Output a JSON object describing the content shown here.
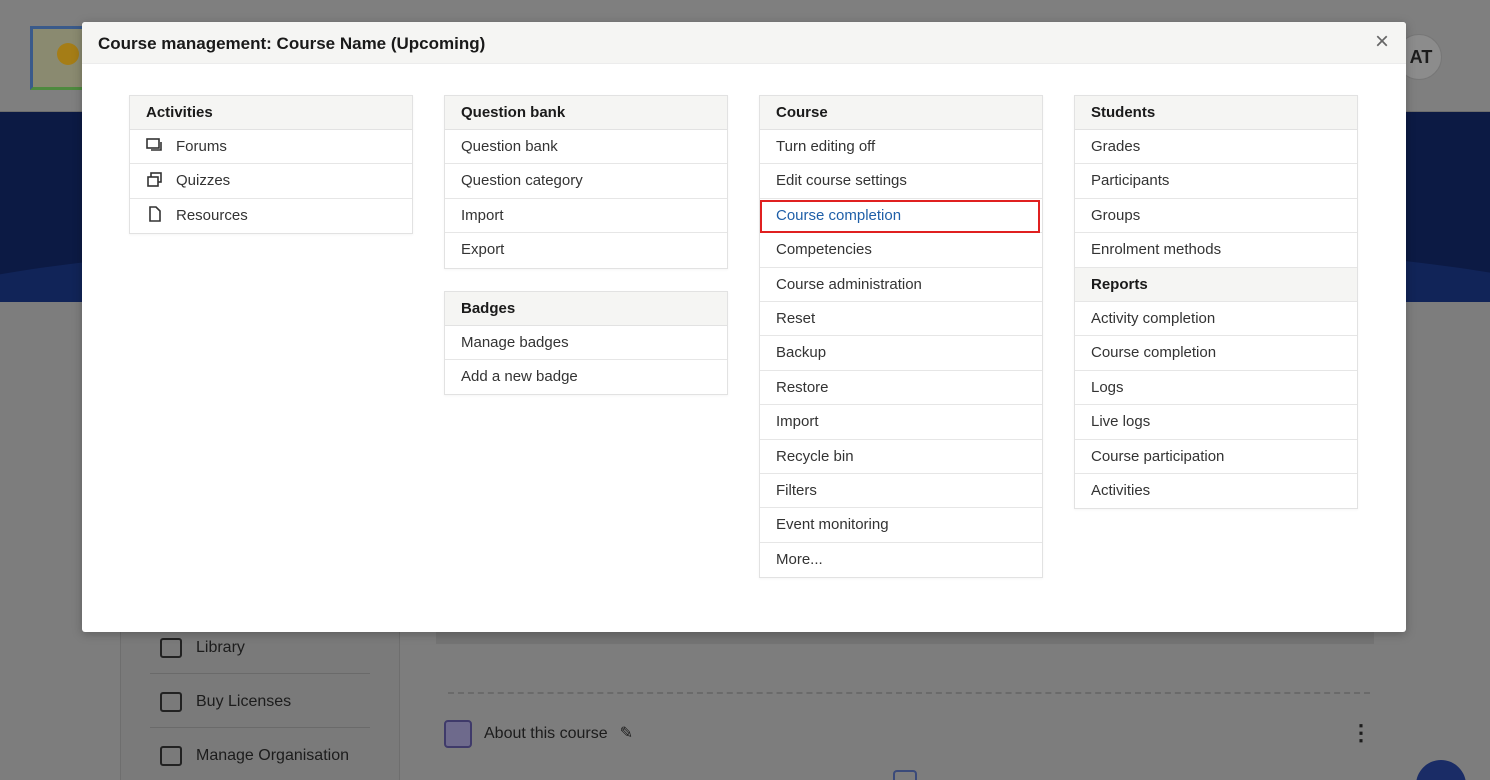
{
  "background": {
    "avatar_initials": "AT",
    "sidebar_items": [
      {
        "label": "Library",
        "icon": "library-icon"
      },
      {
        "label": "Buy Licenses",
        "icon": "money-icon"
      },
      {
        "label": "Manage Organisation",
        "icon": "building-icon"
      }
    ],
    "about_label": "About this course"
  },
  "modal": {
    "title": "Course management: Course Name (Upcoming)",
    "close_symbol": "×"
  },
  "activities": {
    "title": "Activities",
    "items": [
      {
        "label": "Forums",
        "icon": "forum-icon"
      },
      {
        "label": "Quizzes",
        "icon": "quiz-icon"
      },
      {
        "label": "Resources",
        "icon": "file-icon"
      }
    ]
  },
  "question_bank": {
    "title": "Question bank",
    "items": [
      "Question bank",
      "Question category",
      "Import",
      "Export"
    ]
  },
  "badges": {
    "title": "Badges",
    "items": [
      "Manage badges",
      "Add a new badge"
    ]
  },
  "course": {
    "title": "Course",
    "items": [
      "Turn editing off",
      "Edit course settings",
      "Course completion",
      "Competencies",
      "Course administration",
      "Reset",
      "Backup",
      "Restore",
      "Import",
      "Recycle bin",
      "Filters",
      "Event monitoring",
      "More..."
    ],
    "active_item": "Course completion"
  },
  "students": {
    "title": "Students",
    "items": [
      "Grades",
      "Participants",
      "Groups",
      "Enrolment methods"
    ],
    "reports_title": "Reports",
    "report_items": [
      "Activity completion",
      "Course completion",
      "Logs",
      "Live logs",
      "Course participation",
      "Activities"
    ]
  },
  "colors": {
    "link_active": "#1f5fa8",
    "highlight_border": "#e02020",
    "banner": "#0c1a44"
  }
}
